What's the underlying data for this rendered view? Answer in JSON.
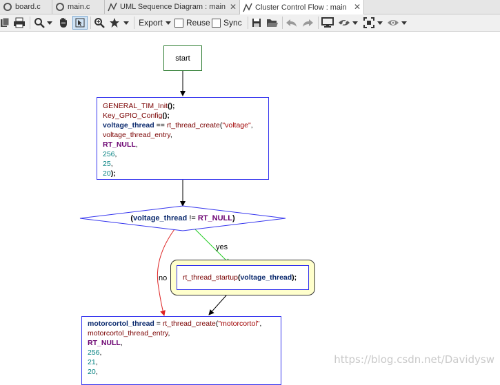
{
  "tabs": [
    {
      "label": "board.c"
    },
    {
      "label": "main.c"
    },
    {
      "label": "UML Sequence Diagram : main"
    },
    {
      "label": "Cluster Control Flow : main"
    }
  ],
  "toolbar": {
    "export_label": "Export",
    "reuse_label": "Reuse",
    "sync_label": "Sync"
  },
  "flow": {
    "start_label": "start",
    "block1": {
      "l1_fn": "GENERAL_TIM_Init",
      "l2_fn": "Key_GPIO_Config",
      "l3_var": "voltage_thread",
      "l3_op": " == ",
      "l3_fn": "rt_thread_create",
      "l3_str": "\"voltage\"",
      "l4_fn": "voltage_thread_entry",
      "l5_mac": "RT_NULL",
      "l6_num": "256",
      "l7_num": "25",
      "l8_num": "20"
    },
    "decision": {
      "var": "voltage_thread",
      "op": " != ",
      "mac": "RT_NULL"
    },
    "yes_label": "yes",
    "no_label": "no",
    "startup": {
      "fn": "rt_thread_startup",
      "var": "voltage_thread"
    },
    "block2": {
      "l1_var": "motorcortol_thread",
      "l1_op": " = ",
      "l1_fn": "rt_thread_create",
      "l1_str": "\"motorcortol\"",
      "l2_fn": "motorcortol_thread_entry",
      "l3_mac": "RT_NULL",
      "l4_num": "256",
      "l5_num": "21",
      "l6_num": "20"
    }
  },
  "watermark": "https://blog.csdn.net/Davidysw",
  "colors": {
    "start_border": "#2e7d32",
    "block_border": "#3333ee",
    "yes_arrow": "#22cc22",
    "no_arrow": "#dd2222",
    "startup_fill": "#ffffcc"
  }
}
